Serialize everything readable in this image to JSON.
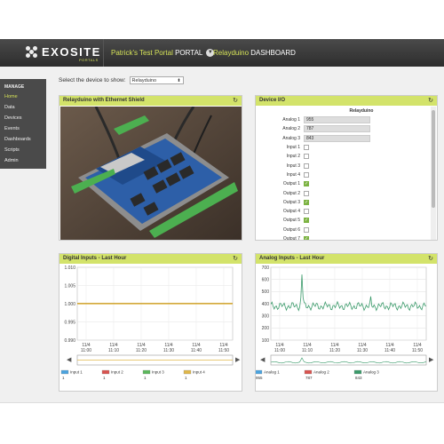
{
  "header": {
    "brand": "EXOSITE",
    "brand_sub": "PORTALS",
    "portal_name": "Patrick's Test Portal",
    "portal_word": "PORTAL",
    "device_name": "Relayduino",
    "dashboard_word": "DASHBOARD"
  },
  "sidebar": {
    "heading": "MANAGE",
    "items": [
      {
        "label": "Home",
        "active": true
      },
      {
        "label": "Data"
      },
      {
        "label": "Devices"
      },
      {
        "label": "Events"
      },
      {
        "label": "Dashboards"
      },
      {
        "label": "Scripts"
      },
      {
        "label": "Admin"
      }
    ]
  },
  "device_select": {
    "label": "Select the device to show:",
    "value": "Relayduino"
  },
  "photo_panel": {
    "title": "Relayduino with Ethernet Shield"
  },
  "io_panel": {
    "title": "Device I/O",
    "device": "Relayduino",
    "analog": [
      {
        "label": "Analog 1",
        "value": "955"
      },
      {
        "label": "Analog 2",
        "value": "787"
      },
      {
        "label": "Analog 3",
        "value": "843"
      }
    ],
    "toggles": [
      {
        "label": "Input 1",
        "on": false
      },
      {
        "label": "Input 2",
        "on": false
      },
      {
        "label": "Input 3",
        "on": false
      },
      {
        "label": "Input 4",
        "on": false
      },
      {
        "label": "Output 1",
        "on": true
      },
      {
        "label": "Output 2",
        "on": false
      },
      {
        "label": "Output 3",
        "on": true
      },
      {
        "label": "Output 4",
        "on": false
      },
      {
        "label": "Output 5",
        "on": true
      },
      {
        "label": "Output 6",
        "on": false
      },
      {
        "label": "Output 7",
        "on": true
      }
    ]
  },
  "refresh_icon": "refresh-icon",
  "chart_data": [
    {
      "type": "line",
      "title": "Digital Inputs - Last Hour",
      "ylim": [
        0.99,
        1.01
      ],
      "yticks": [
        "1.010",
        "1.005",
        "1.000",
        "0.995",
        "0.990"
      ],
      "xticks": [
        "11/4 11:00",
        "11/4 11:10",
        "11/4 11:20",
        "11/4 11:30",
        "11/4 11:40",
        "11/4 11:50"
      ],
      "series": [
        {
          "name": "Input 1",
          "color": "#4aa3df",
          "last": "1",
          "values": [
            1,
            1
          ]
        },
        {
          "name": "Input 2",
          "color": "#d9534f",
          "last": "1",
          "values": [
            1,
            1
          ]
        },
        {
          "name": "Input 3",
          "color": "#5cb85c",
          "last": "1",
          "values": [
            1,
            1
          ]
        },
        {
          "name": "Input 4",
          "color": "#e0b84a",
          "last": "1",
          "values": [
            1,
            1
          ]
        }
      ]
    },
    {
      "type": "line",
      "title": "Analog Inputs - Last Hour",
      "ylim": [
        100,
        700
      ],
      "yticks": [
        "700",
        "600",
        "500",
        "400",
        "300",
        "200",
        "100"
      ],
      "xticks": [
        "11/4 11:00",
        "11/4 11:10",
        "11/4 11:20",
        "11/4 11:30",
        "11/4 11:40",
        "11/4 11:50"
      ],
      "series": [
        {
          "name": "Analog 1",
          "color": "#4aa3df",
          "last": "955"
        },
        {
          "name": "Analog 2",
          "color": "#d9534f",
          "last": "787"
        },
        {
          "name": "Analog 3",
          "color": "#3a9a6a",
          "last": "843",
          "baseline": 380,
          "spike": 640
        }
      ]
    }
  ]
}
